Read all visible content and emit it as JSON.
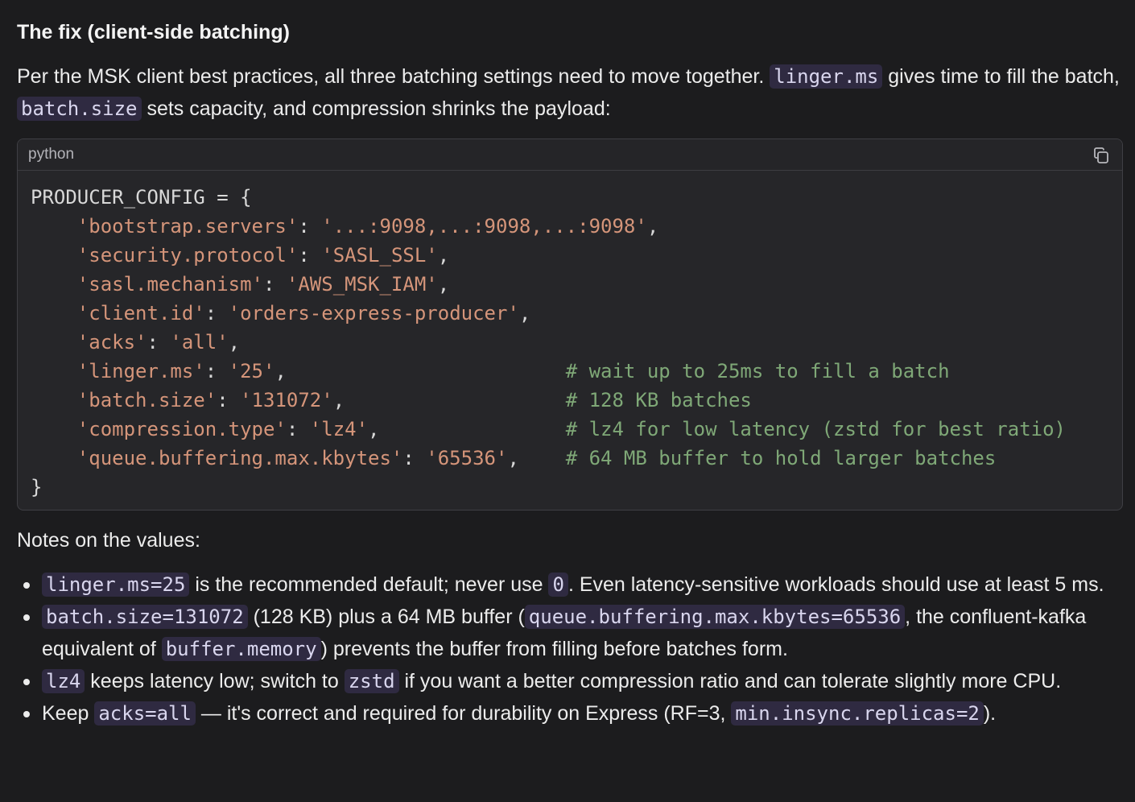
{
  "section_title": "The fix (client-side batching)",
  "intro": {
    "t1": "Per the MSK client best practices, all three batching settings need to move together. ",
    "c1": "linger.ms",
    "t2": " gives time to fill the batch, ",
    "c2": "batch.size",
    "t3": " sets capacity, and compression shrinks the payload:"
  },
  "code_block": {
    "language": "python",
    "copy_icon": "copy-icon",
    "open_line": "PRODUCER_CONFIG = {",
    "close_line": "}",
    "entries": [
      {
        "key": "'bootstrap.servers'",
        "value": "'...:9098,...:9098,...:9098'",
        "comment": ""
      },
      {
        "key": "'security.protocol'",
        "value": "'SASL_SSL'",
        "comment": ""
      },
      {
        "key": "'sasl.mechanism'",
        "value": "'AWS_MSK_IAM'",
        "comment": ""
      },
      {
        "key": "'client.id'",
        "value": "'orders-express-producer'",
        "comment": ""
      },
      {
        "key": "'acks'",
        "value": "'all'",
        "comment": ""
      },
      {
        "key": "'linger.ms'",
        "value": "'25'",
        "comment": "# wait up to 25ms to fill a batch"
      },
      {
        "key": "'batch.size'",
        "value": "'131072'",
        "comment": "# 128 KB batches"
      },
      {
        "key": "'compression.type'",
        "value": "'lz4'",
        "comment": "# lz4 for low latency (zstd for best ratio)"
      },
      {
        "key": "'queue.buffering.max.kbytes'",
        "value": "'65536'",
        "comment": "# 64 MB buffer to hold larger batches"
      }
    ]
  },
  "notes_title": "Notes on the values:",
  "notes": [
    [
      {
        "code": "linger.ms=25"
      },
      {
        "text": " is the recommended default; never use "
      },
      {
        "code": "0"
      },
      {
        "text": ". Even latency-sensitive workloads should use at least 5 ms."
      }
    ],
    [
      {
        "code": "batch.size=131072"
      },
      {
        "text": " (128 KB) plus a 64 MB buffer ("
      },
      {
        "code": "queue.buffering.max.kbytes=65536"
      },
      {
        "text": ", the confluent-kafka equivalent of "
      },
      {
        "code": "buffer.memory"
      },
      {
        "text": ") prevents the buffer from filling before batches form."
      }
    ],
    [
      {
        "code": "lz4"
      },
      {
        "text": " keeps latency low; switch to "
      },
      {
        "code": "zstd"
      },
      {
        "text": " if you want a better compression ratio and can tolerate slightly more CPU."
      }
    ],
    [
      {
        "text": "Keep "
      },
      {
        "code": "acks=all"
      },
      {
        "text": " — it's correct and required for durability on Express (RF=3, "
      },
      {
        "code": "min.insync.replicas=2"
      },
      {
        "text": ")."
      }
    ]
  ]
}
